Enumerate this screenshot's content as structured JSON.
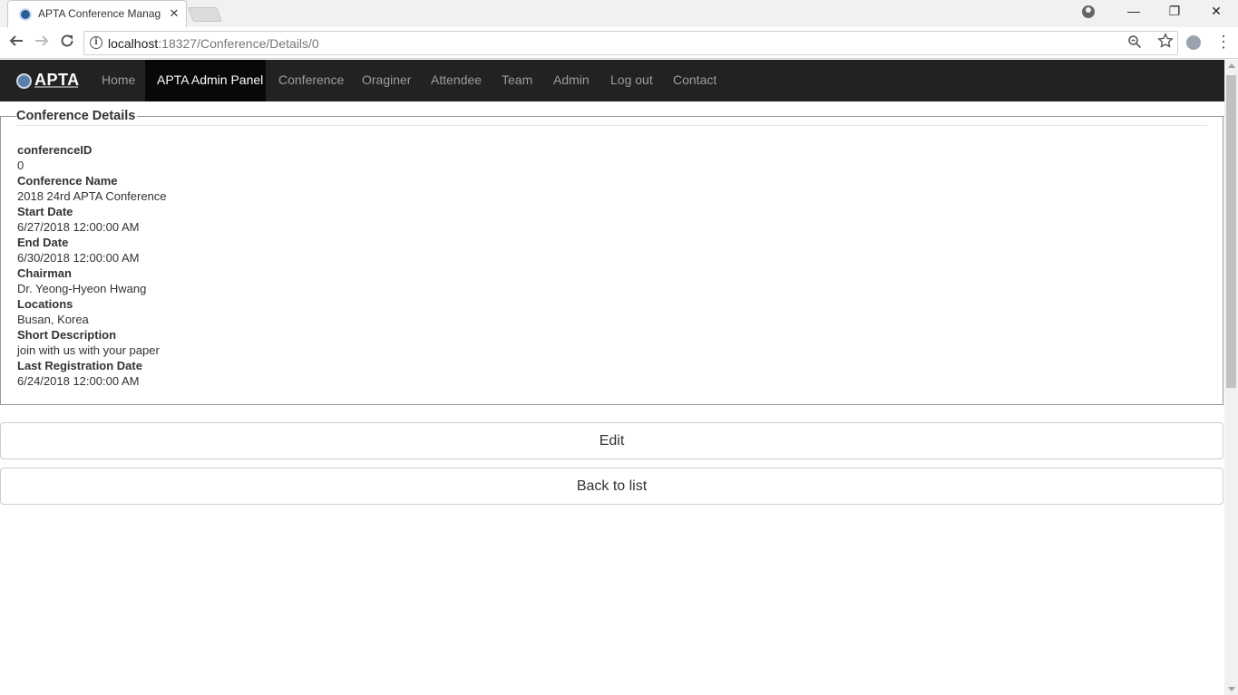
{
  "browser": {
    "tab_title": "APTA Conference Manag",
    "tab_close": "✕",
    "url_host": "localhost",
    "url_rest": ":18327/Conference/Details/0",
    "window_minimize": "—",
    "window_restore": "❐",
    "window_close": "✕"
  },
  "navbar": {
    "brand": "APTA",
    "items": [
      {
        "label": "Home",
        "active": false
      },
      {
        "label": "APTA Admin Panel",
        "active": true
      },
      {
        "label": "Conference",
        "active": false
      },
      {
        "label": "Oraginer",
        "active": false
      },
      {
        "label": "Attendee",
        "active": false
      },
      {
        "label": "Team",
        "active": false
      },
      {
        "label": "Admin",
        "active": false
      },
      {
        "label": "Log out",
        "active": false
      },
      {
        "label": "Contact",
        "active": false
      }
    ]
  },
  "details": {
    "legend": "Conference Details",
    "fields": [
      {
        "label": "conferenceID",
        "value": "0"
      },
      {
        "label": "Conference Name",
        "value": "2018 24rd APTA Conference"
      },
      {
        "label": "Start Date",
        "value": "6/27/2018 12:00:00 AM"
      },
      {
        "label": "End Date",
        "value": "6/30/2018 12:00:00 AM"
      },
      {
        "label": "Chairman",
        "value": "Dr. Yeong-Hyeon Hwang"
      },
      {
        "label": "Locations",
        "value": "Busan, Korea"
      },
      {
        "label": "Short Description",
        "value": "join with us with your paper"
      },
      {
        "label": "Last Registration Date",
        "value": "6/24/2018 12:00:00 AM"
      }
    ]
  },
  "actions": {
    "edit": "Edit",
    "back": "Back to list"
  },
  "icons": {
    "back": "back-arrow-icon",
    "forward": "forward-arrow-icon",
    "reload": "reload-icon",
    "info": "info-icon",
    "zoom": "zoom-icon",
    "bookmark": "star-icon",
    "extension": "extension-icon",
    "menu": "kebab-menu-icon",
    "account": "account-icon"
  }
}
